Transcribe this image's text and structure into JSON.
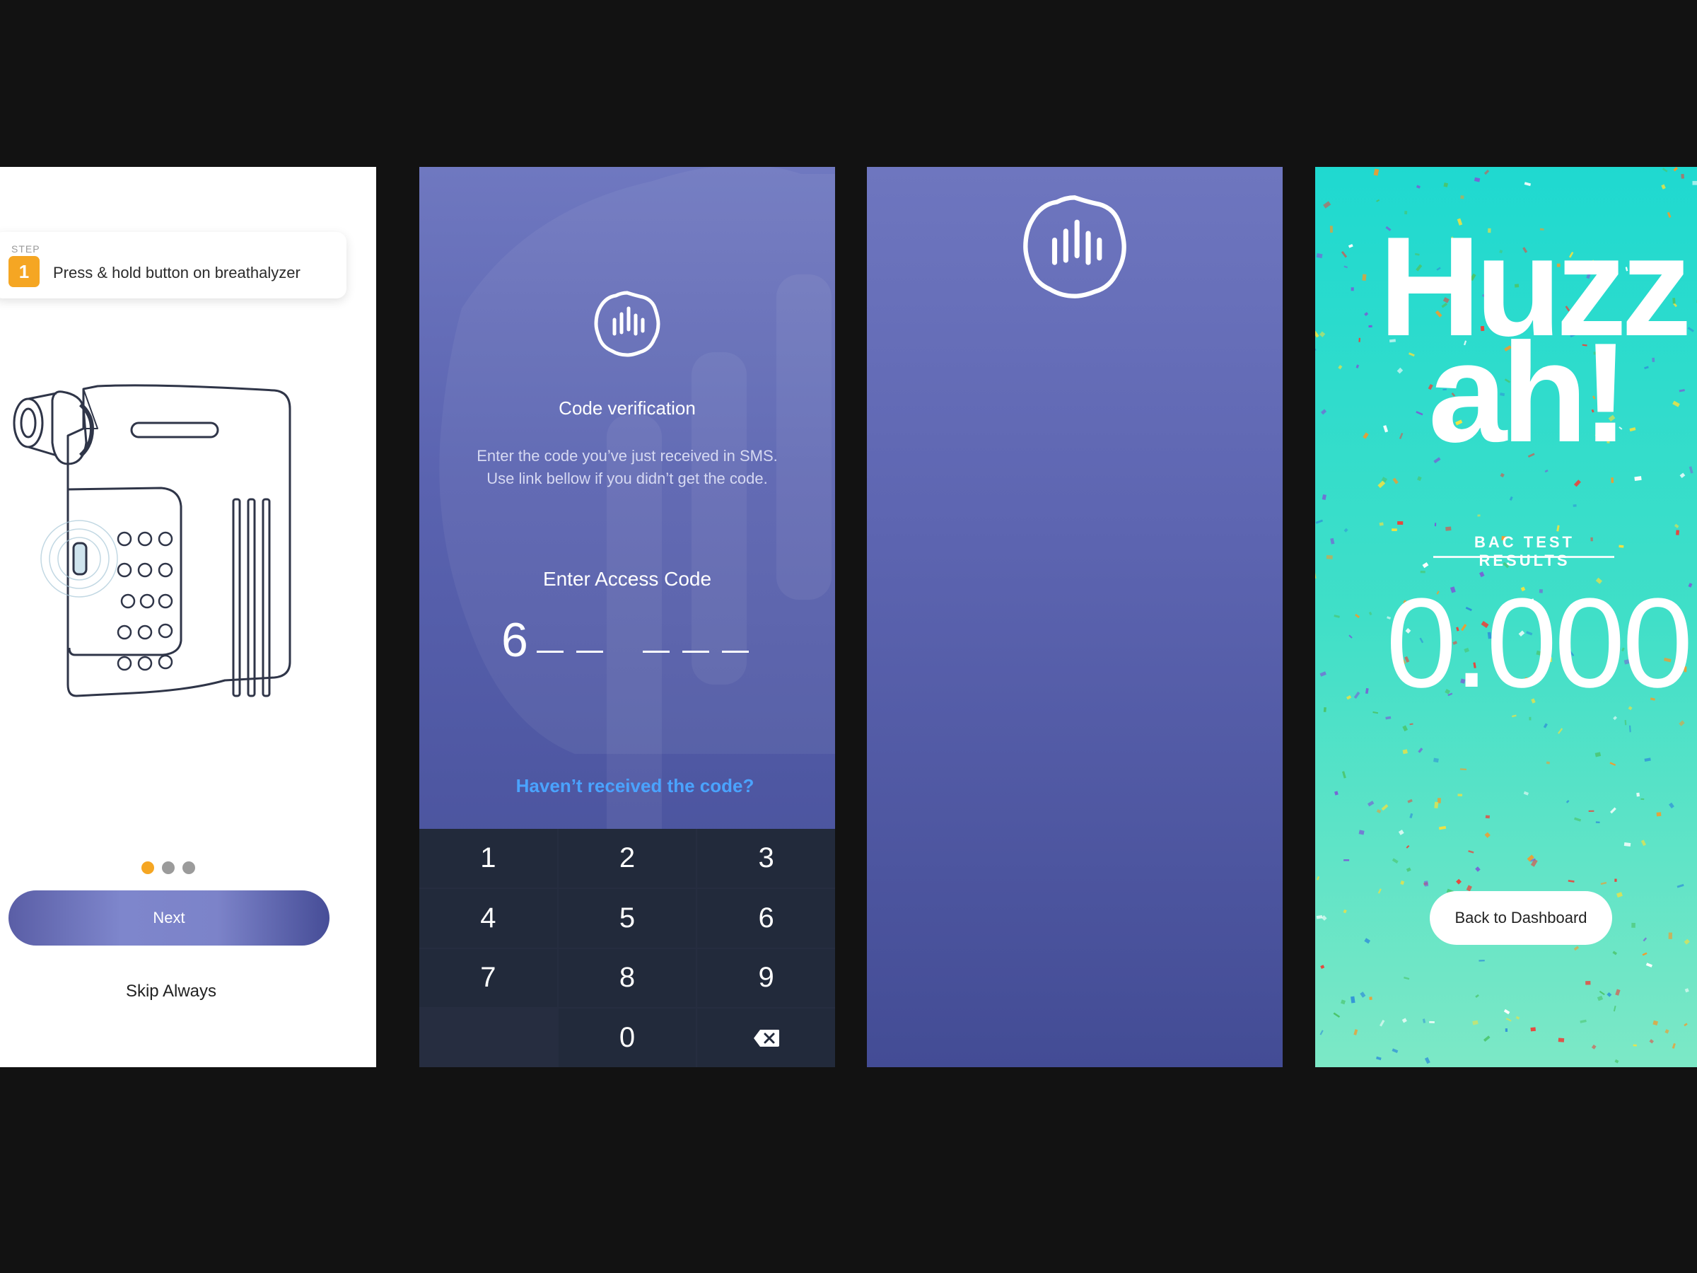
{
  "onboarding": {
    "step_caption": "STEP",
    "step_number": "1",
    "step_text": "Press & hold button on breathalyzer",
    "pagination": {
      "total": 3,
      "active": 1
    },
    "next_label": "Next",
    "skip_label": "Skip Always",
    "accent": "#f5a623"
  },
  "verification": {
    "title": "Code verification",
    "desc_line1": "Enter the code you’ve just received in SMS.",
    "desc_line2": "Use link bellow if you didn’t get the code.",
    "access_label": "Enter Access Code",
    "entered_digit": "6",
    "code_length": 6,
    "resend_label": "Haven’t received the code?",
    "keypad": [
      "1",
      "2",
      "3",
      "4",
      "5",
      "6",
      "7",
      "8",
      "9",
      "",
      "0",
      "backspace-icon"
    ]
  },
  "analyzing": {
    "logo_icon": "breath-wave-logo-icon",
    "waveform_colors": [
      "#f7d774",
      "#f08a3c"
    ]
  },
  "results": {
    "headline_line1": "Huzz",
    "headline_line2": "ah!",
    "bac_label": "BAC TEST RESULTS",
    "bac_value": "0.000",
    "dashboard_label": "Back to Dashboard"
  }
}
